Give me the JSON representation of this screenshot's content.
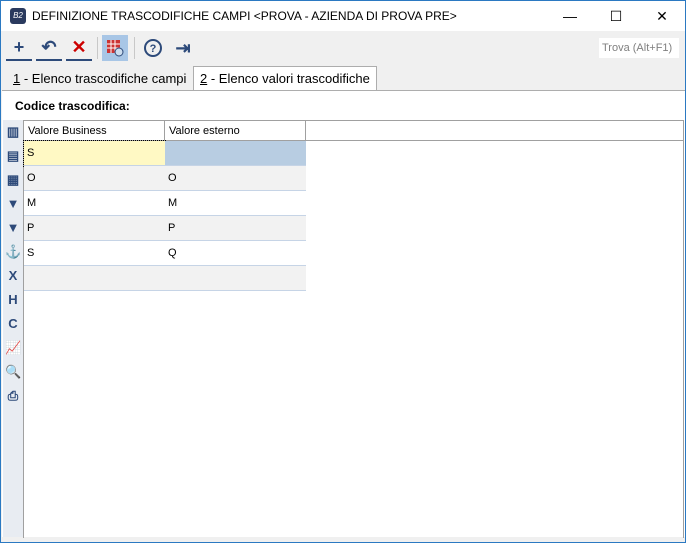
{
  "window": {
    "title": "DEFINIZIONE TRASCODIFICHE CAMPI <PROVA - AZIENDA DI PROVA PRE>",
    "app_icon": "B2",
    "minimize": "—",
    "maximize": "☐",
    "close": "✕"
  },
  "toolbar": {
    "search_placeholder": "Trova (Alt+F1)"
  },
  "tabs": [
    {
      "num": "1",
      "label": " - Elenco trascodifiche campi"
    },
    {
      "num": "2",
      "label": " - Elenco valori trascodifiche"
    }
  ],
  "form": {
    "codice_label": "Codice trascodifica:"
  },
  "grid": {
    "columns": [
      "Valore Business",
      "Valore esterno"
    ],
    "rows": [
      [
        "S",
        ""
      ],
      [
        "O",
        "O"
      ],
      [
        "M",
        "M"
      ],
      [
        "P",
        "P"
      ],
      [
        "S",
        "Q"
      ],
      [
        "",
        ""
      ]
    ]
  },
  "colors": {
    "accent": "#2d4a7a",
    "selected_cell": "#fff9c4",
    "selected_row": "#b8cde2"
  }
}
